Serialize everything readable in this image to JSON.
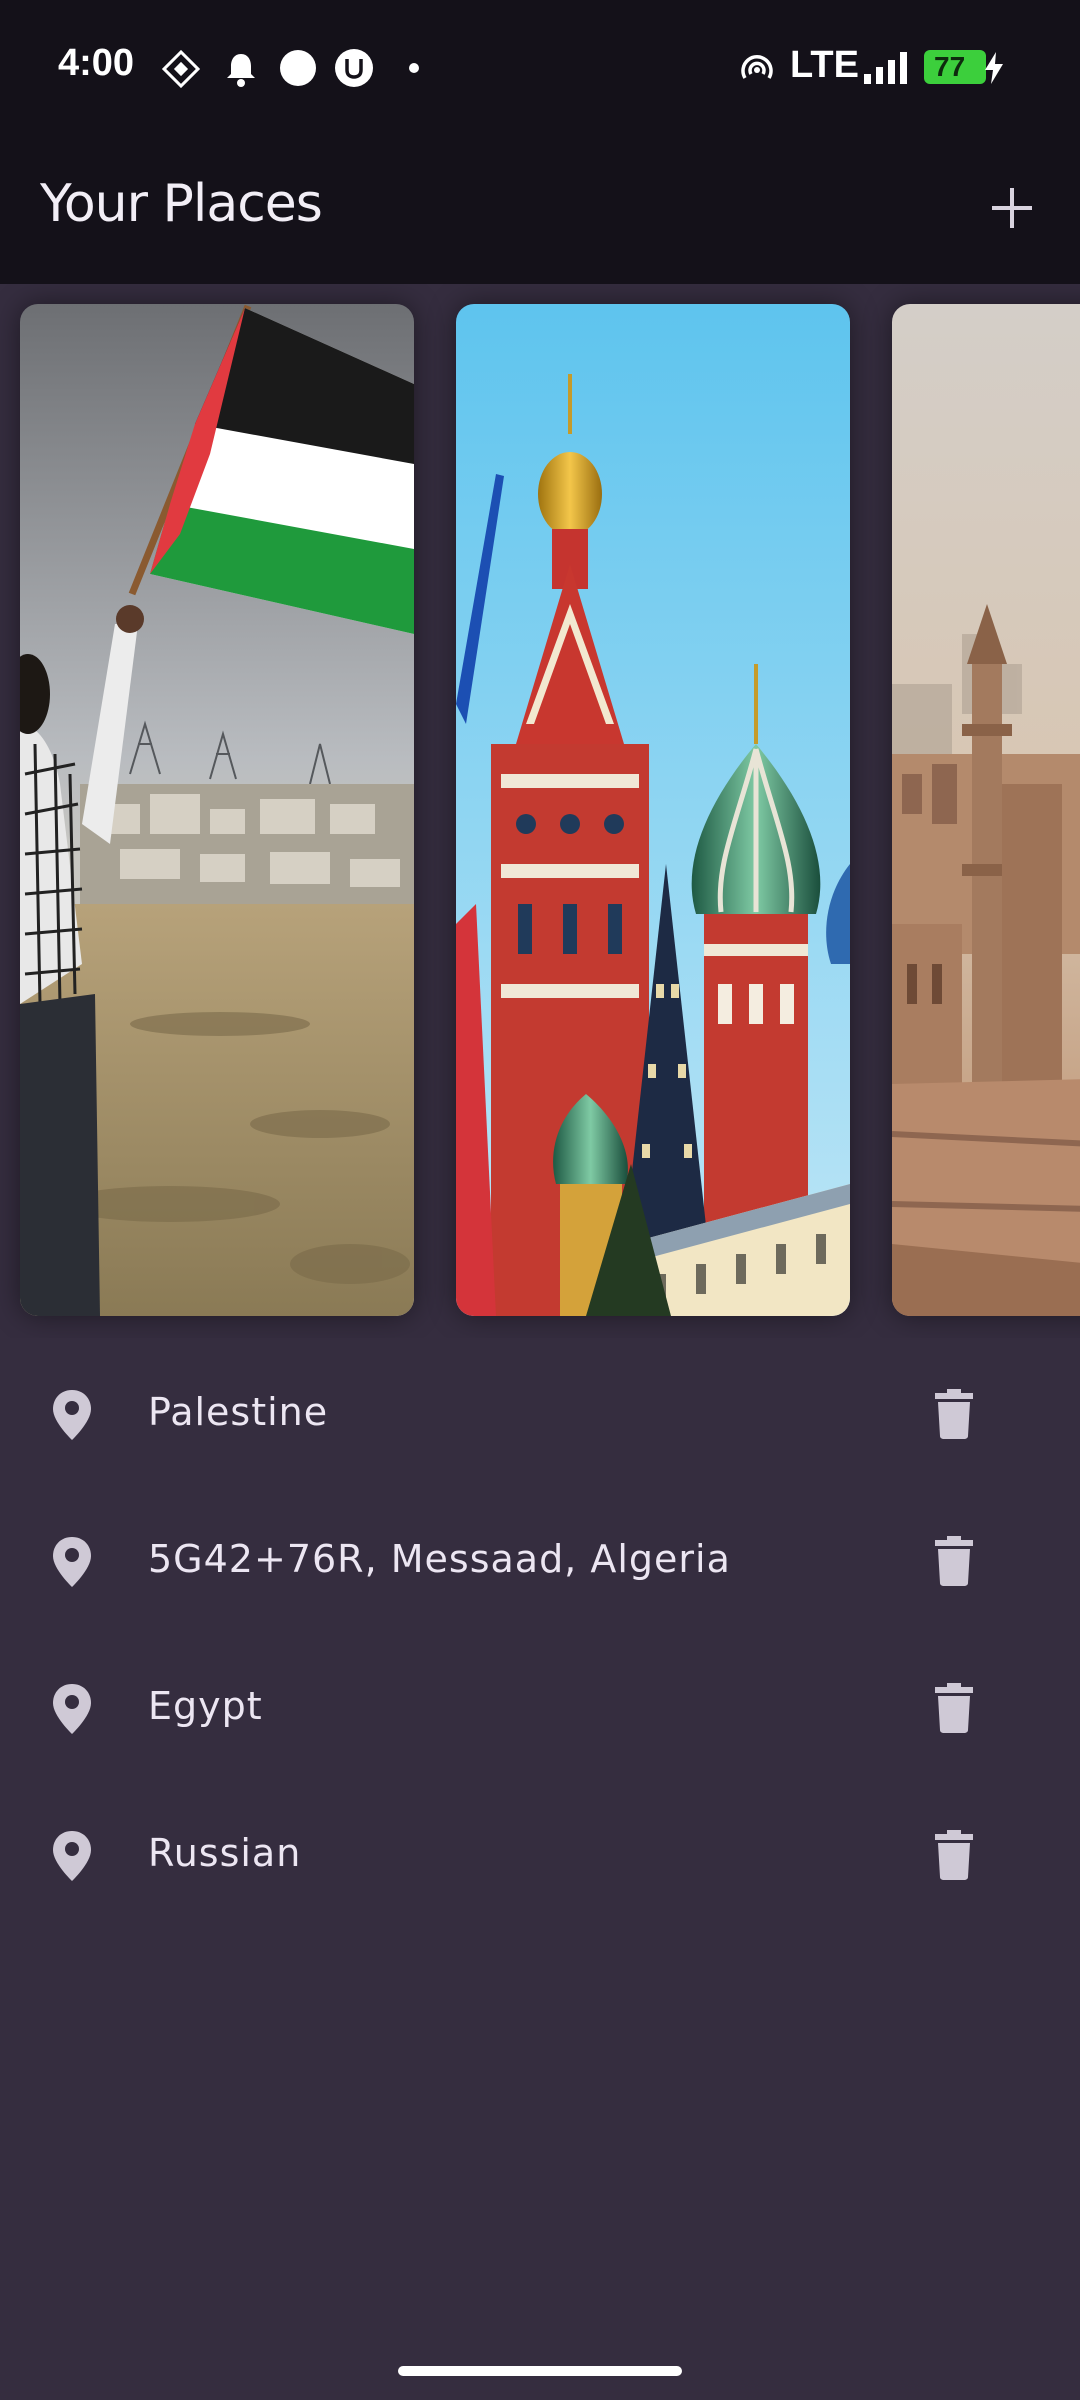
{
  "status_bar": {
    "time": "4:00",
    "network": "LTE",
    "battery": "77",
    "icons": [
      "diamond-app-icon",
      "bell-icon",
      "circle-icon",
      "u-app-icon",
      "dot-icon",
      "hotspot-icon",
      "signal-icon",
      "battery-icon",
      "charging-icon"
    ]
  },
  "appbar": {
    "title": "Your Places",
    "add_icon": "plus-icon"
  },
  "carousel": {
    "cards": [
      {
        "name": "palestine-image"
      },
      {
        "name": "russia-image"
      },
      {
        "name": "egypt-image"
      }
    ]
  },
  "places": [
    {
      "label": "Palestine",
      "icon": "location-pin-icon",
      "action_icon": "trash-icon"
    },
    {
      "label": "5G42+76R, Messaad, Algeria",
      "icon": "location-pin-icon",
      "action_icon": "trash-icon"
    },
    {
      "label": "Egypt",
      "icon": "location-pin-icon",
      "action_icon": "trash-icon"
    },
    {
      "label": "Russian",
      "icon": "location-pin-icon",
      "action_icon": "trash-icon"
    }
  ],
  "colors": {
    "background": "#352d3f",
    "appbar": "#141119",
    "icon": "#cfc9d6",
    "battery": "#3ccf3c"
  }
}
